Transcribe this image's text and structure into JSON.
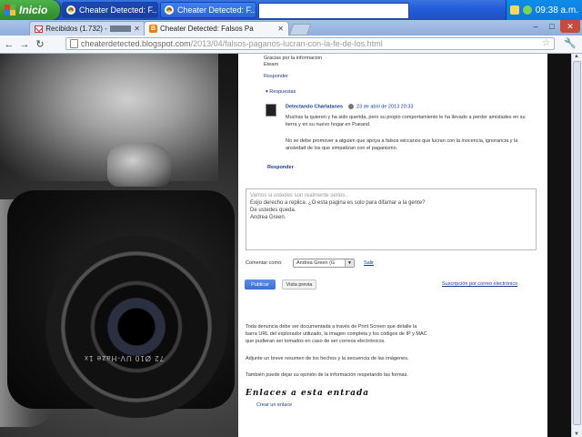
{
  "taskbar": {
    "start_label": "Inicio",
    "tasks": [
      {
        "label": "Cheater Detected: F..."
      },
      {
        "label": "Cheater Detected: F..."
      }
    ],
    "clock": "09:38 a.m."
  },
  "browser": {
    "tabs": [
      {
        "label": "Recibidos (1.732) -"
      },
      {
        "label": "Cheater Detected: Falsos Pa"
      }
    ],
    "url_domain": "cheaterdetected.blogspot.com",
    "url_path": "/2013/04/falsos-paganos-lucran-con-la-fe-de-los.html"
  },
  "comments": {
    "top_text_1": "Gracias por la informacion",
    "top_text_2": "Etearn",
    "reply_link": "Responder",
    "replies_label": "Respuestas",
    "reply": {
      "author": "Detectando Charlatanes",
      "date": "23 de abril de 2013 20:33",
      "p1_l1": "Muchas la quieren y ha sido querida, pero su propio comportamiento le ha llevado a perder amistades en su",
      "p1_l2": "tierra y en su nuevo hogar en Pueand.",
      "p2_l1": "No se debe promover a alguien que apoya a falsos wiccanos que lucran con la inocencia, ignorancia y la",
      "p2_l2": "ansiedad de los que simpatizan con el paganismo."
    },
    "reply_link_2": "Responder"
  },
  "form": {
    "textarea_lines": [
      "Vamos si ustedes son realmente serios..",
      "Exijo derecho a replica. ¿O esta pagina es solo para difamar a la gente?",
      "De ustedes queda.",
      "Andrea Green."
    ],
    "comment_as_label": "Comentar como:",
    "comment_as_value": "Andrea Green (G",
    "logout_link": "Salir",
    "publish_button": "Publicar",
    "preview_button": "Vista previa",
    "subscribe_link": "Suscripción por correo electrónico"
  },
  "footer": {
    "p1_l1": "Toda denuncia debe ser documentada a través de Print Screen que detalle la",
    "p1_l2": "barra URL del explorador utilizado, la imagen completa y los códigos de IP y MAC",
    "p1_l3": "que pudieran ser tomados en caso de ser correos electrónicos.",
    "p2": "Adjunte un breve resumen de los hechos y la secuencia de las imágenes.",
    "p3": "También puede dejar su opinión de la información respetando las formas.",
    "section_title": "Enlaces a esta entrada",
    "create_link": "Crear un enlace"
  },
  "photo": {
    "lens_text": "72 Ø10 UV-Haze 1x"
  }
}
